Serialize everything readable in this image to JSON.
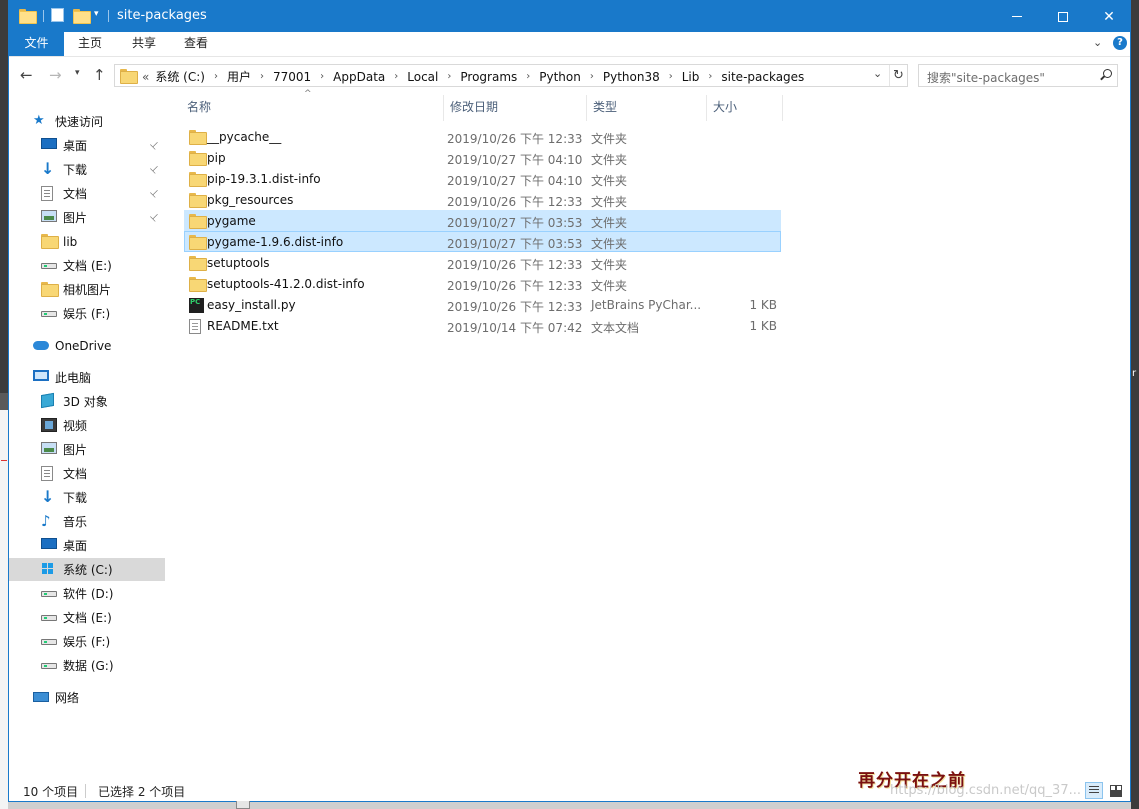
{
  "window": {
    "title": "site-packages"
  },
  "ribbon": {
    "tabs": [
      {
        "label": "文件"
      },
      {
        "label": "主页"
      },
      {
        "label": "共享"
      },
      {
        "label": "查看"
      }
    ],
    "help_label": "?"
  },
  "nav": {
    "address_prefix": "«",
    "crumbs": [
      "系统 (C:)",
      "用户",
      "77001",
      "AppData",
      "Local",
      "Programs",
      "Python",
      "Python38",
      "Lib",
      "site-packages"
    ],
    "search_placeholder": "搜索\"site-packages\""
  },
  "sidebar": {
    "quick_access": {
      "label": "快速访问",
      "items": [
        {
          "label": "桌面",
          "icon": "desktop-icon",
          "pinned": true
        },
        {
          "label": "下载",
          "icon": "download-icon",
          "pinned": true
        },
        {
          "label": "文档",
          "icon": "document-icon",
          "pinned": true
        },
        {
          "label": "图片",
          "icon": "pictures-icon",
          "pinned": true
        },
        {
          "label": "lib",
          "icon": "folder-icon"
        },
        {
          "label": "文档 (E:)",
          "icon": "drive-icon"
        },
        {
          "label": "相机图片",
          "icon": "folder-icon"
        },
        {
          "label": "娱乐 (F:)",
          "icon": "drive-icon"
        }
      ]
    },
    "onedrive": {
      "label": "OneDrive"
    },
    "this_pc": {
      "label": "此电脑",
      "items": [
        {
          "label": "3D 对象",
          "icon": "3d-objects-icon"
        },
        {
          "label": "视频",
          "icon": "video-icon"
        },
        {
          "label": "图片",
          "icon": "pictures-icon"
        },
        {
          "label": "文档",
          "icon": "document-icon"
        },
        {
          "label": "下载",
          "icon": "download-icon"
        },
        {
          "label": "音乐",
          "icon": "music-icon"
        },
        {
          "label": "桌面",
          "icon": "desktop-icon"
        },
        {
          "label": "系统 (C:)",
          "icon": "windows-drive-icon",
          "selected": true
        },
        {
          "label": "软件 (D:)",
          "icon": "drive-icon"
        },
        {
          "label": "文档 (E:)",
          "icon": "drive-icon"
        },
        {
          "label": "娱乐 (F:)",
          "icon": "drive-icon"
        },
        {
          "label": "数据 (G:)",
          "icon": "drive-icon"
        }
      ]
    },
    "network": {
      "label": "网络"
    }
  },
  "columns": {
    "name": "名称",
    "date": "修改日期",
    "type": "类型",
    "size": "大小"
  },
  "files": [
    {
      "name": "__pycache__",
      "date": "2019/10/26 下午 12:33",
      "type": "文件夹",
      "size": "",
      "icon": "folder-icon"
    },
    {
      "name": "pip",
      "date": "2019/10/27 下午 04:10",
      "type": "文件夹",
      "size": "",
      "icon": "folder-icon"
    },
    {
      "name": "pip-19.3.1.dist-info",
      "date": "2019/10/27 下午 04:10",
      "type": "文件夹",
      "size": "",
      "icon": "folder-icon"
    },
    {
      "name": "pkg_resources",
      "date": "2019/10/26 下午 12:33",
      "type": "文件夹",
      "size": "",
      "icon": "folder-icon"
    },
    {
      "name": "pygame",
      "date": "2019/10/27 下午 03:53",
      "type": "文件夹",
      "size": "",
      "icon": "folder-icon",
      "selected": true
    },
    {
      "name": "pygame-1.9.6.dist-info",
      "date": "2019/10/27 下午 03:53",
      "type": "文件夹",
      "size": "",
      "icon": "folder-icon",
      "selected": true,
      "focused": true
    },
    {
      "name": "setuptools",
      "date": "2019/10/26 下午 12:33",
      "type": "文件夹",
      "size": "",
      "icon": "folder-icon"
    },
    {
      "name": "setuptools-41.2.0.dist-info",
      "date": "2019/10/26 下午 12:33",
      "type": "文件夹",
      "size": "",
      "icon": "folder-icon"
    },
    {
      "name": "easy_install.py",
      "date": "2019/10/26 下午 12:33",
      "type": "JetBrains PyChar...",
      "size": "1 KB",
      "icon": "pycharm-file-icon"
    },
    {
      "name": "README.txt",
      "date": "2019/10/14 下午 07:42",
      "type": "文本文档",
      "size": "1 KB",
      "icon": "text-file-icon"
    }
  ],
  "status": {
    "count": "10 个项目",
    "selected": "已选择 2 个项目"
  },
  "overlay": {
    "caption": "再分开在之前",
    "url": "https://blog.csdn.net/qq_37..."
  }
}
